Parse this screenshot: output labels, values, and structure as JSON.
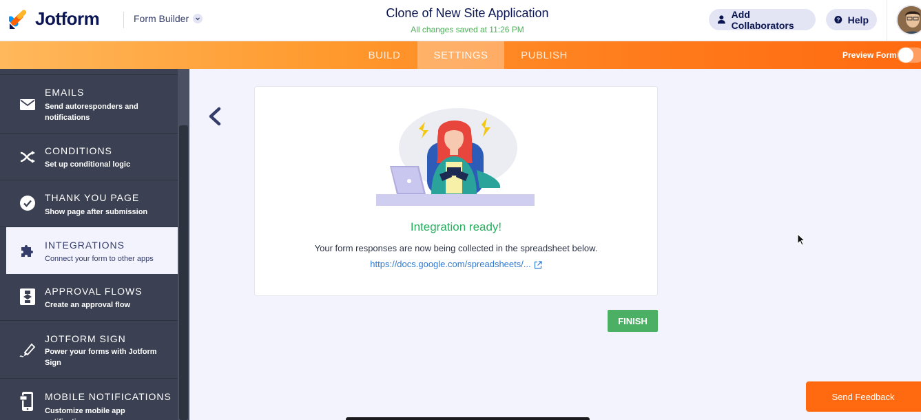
{
  "header": {
    "logo_text": "Jotform",
    "builder_dropdown": "Form Builder",
    "form_title": "Clone of New Site Application",
    "save_status": "All changes saved at 11:26 PM",
    "add_collaborators": "Add Collaborators",
    "help": "Help"
  },
  "nav": {
    "tabs": [
      {
        "label": "BUILD",
        "active": false
      },
      {
        "label": "SETTINGS",
        "active": true
      },
      {
        "label": "PUBLISH",
        "active": false
      }
    ],
    "preview_form": "Preview Form"
  },
  "sidebar": {
    "items": [
      {
        "title": "EMAILS",
        "subtitle": "Send autoresponders and notifications",
        "icon": "envelope-icon"
      },
      {
        "title": "CONDITIONS",
        "subtitle": "Set up conditional logic",
        "icon": "shuffle-icon"
      },
      {
        "title": "THANK YOU PAGE",
        "subtitle": "Show page after submission",
        "icon": "check-circle-icon"
      },
      {
        "title": "INTEGRATIONS",
        "subtitle": "Connect your form to other apps",
        "icon": "puzzle-icon",
        "active": true
      },
      {
        "title": "APPROVAL FLOWS",
        "subtitle": "Create an approval flow",
        "icon": "flow-icon"
      },
      {
        "title": "JOTFORM SIGN",
        "subtitle": "Power your forms with Jotform Sign",
        "icon": "pen-icon"
      },
      {
        "title": "MOBILE NOTIFICATIONS",
        "subtitle": "Customize mobile app notifications",
        "icon": "mobile-icon"
      }
    ]
  },
  "integration": {
    "title": "Integration ready!",
    "description": "Your form responses are now being collected in the spreadsheet below.",
    "link": "https://docs.google.com/spreadsheets/..."
  },
  "buttons": {
    "finish": "FINISH",
    "send_feedback": "Send Feedback"
  },
  "colors": {
    "brand_orange": "#ff6a10",
    "sidebar_bg": "#3b4152",
    "success_green": "#27ae60",
    "finish_green": "#4bb063",
    "link_blue": "#2f79d0"
  }
}
